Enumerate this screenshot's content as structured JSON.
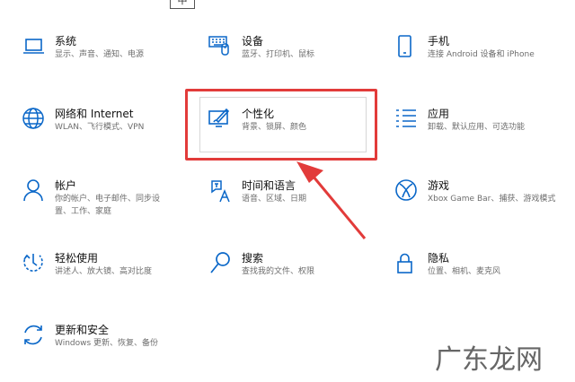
{
  "top_fragment": "中",
  "accent_color": "#0a67c8",
  "highlight_color": "#e23b3a",
  "tiles": [
    {
      "title": "系统",
      "desc": "显示、声音、通知、电源",
      "icon": "laptop-icon"
    },
    {
      "title": "设备",
      "desc": "蓝牙、打印机、鼠标",
      "icon": "keyboard-icon"
    },
    {
      "title": "手机",
      "desc": "连接 Android 设备和 iPhone",
      "icon": "phone-icon"
    },
    {
      "title": "网络和 Internet",
      "desc": "WLAN、飞行模式、VPN",
      "icon": "globe-icon"
    },
    {
      "title": "个性化",
      "desc": "背景、锁屏、颜色",
      "icon": "paint-icon"
    },
    {
      "title": "应用",
      "desc": "卸载、默认应用、可选功能",
      "icon": "apps-list-icon"
    },
    {
      "title": "帐户",
      "desc": "你的帐户、电子邮件、同步设置、工作、家庭",
      "icon": "person-icon"
    },
    {
      "title": "时间和语言",
      "desc": "语音、区域、日期",
      "icon": "time-language-icon"
    },
    {
      "title": "游戏",
      "desc": "Xbox Game Bar、捕获、游戏模式",
      "icon": "xbox-icon"
    },
    {
      "title": "轻松使用",
      "desc": "讲述人、放大镜、高对比度",
      "icon": "ease-of-access-icon"
    },
    {
      "title": "搜索",
      "desc": "查找我的文件、权限",
      "icon": "search-icon"
    },
    {
      "title": "隐私",
      "desc": "位置、相机、麦克风",
      "icon": "lock-icon"
    },
    {
      "title": "更新和安全",
      "desc": "Windows 更新、恢复、备份",
      "icon": "sync-icon"
    }
  ],
  "watermark": "广东龙网"
}
